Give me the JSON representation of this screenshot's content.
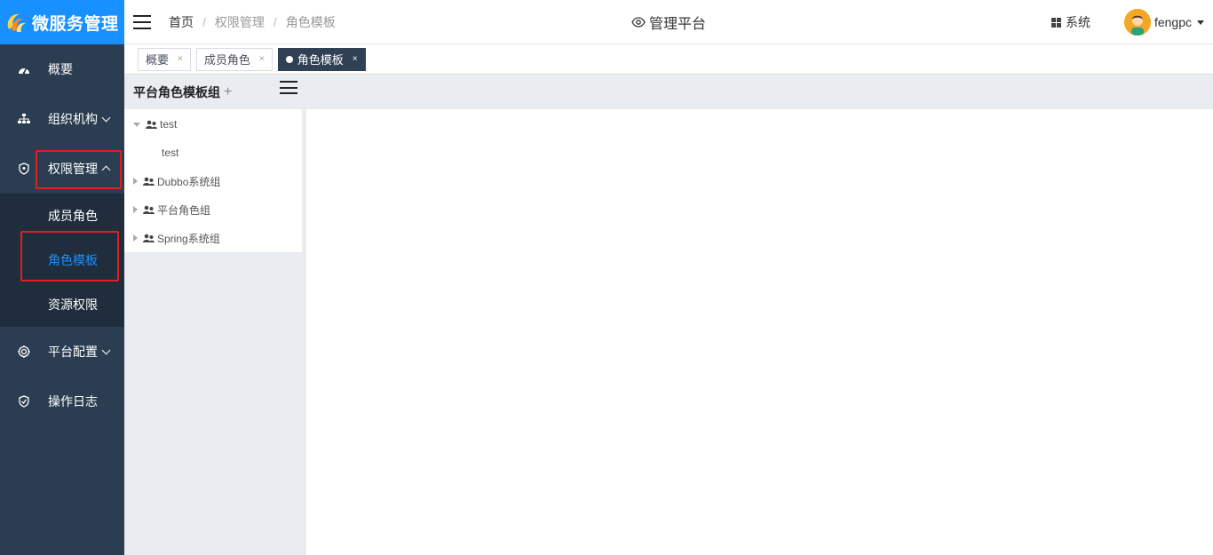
{
  "app": {
    "logo_text": "微服务管理"
  },
  "sidebar": {
    "items": [
      {
        "label": "概要",
        "icon": "dashboard-icon"
      },
      {
        "label": "组织机构",
        "icon": "org-tree-icon"
      },
      {
        "label": "权限管理",
        "icon": "shield-icon",
        "expanded": true
      },
      {
        "label": "平台配置",
        "icon": "gear-icon"
      },
      {
        "label": "操作日志",
        "icon": "log-icon"
      }
    ],
    "submenu": [
      {
        "label": "成员角色"
      },
      {
        "label": "角色模板",
        "active": true
      },
      {
        "label": "资源权限"
      }
    ]
  },
  "header": {
    "breadcrumb": [
      "首页",
      "权限管理",
      "角色模板"
    ],
    "center_title": "管理平台",
    "system_label": "系统",
    "username": "fengpc"
  },
  "tabs": [
    {
      "label": "概要",
      "close": "×"
    },
    {
      "label": "成员角色",
      "close": "×"
    },
    {
      "label": "角色模板",
      "close": "×",
      "active": true
    }
  ],
  "tree": {
    "title": "平台角色模板组",
    "add_symbol": "+",
    "nodes": [
      {
        "label": "test",
        "expanded": true
      },
      {
        "label": "test"
      },
      {
        "label": "Dubbo系统组"
      },
      {
        "label": "平台角色组"
      },
      {
        "label": "Spring系统组"
      }
    ]
  },
  "colors": {
    "accent": "#1890ff",
    "sidebar_bg": "#2b3d50",
    "submenu_bg": "#1f2d3d",
    "highlight_box": "#e02020"
  }
}
